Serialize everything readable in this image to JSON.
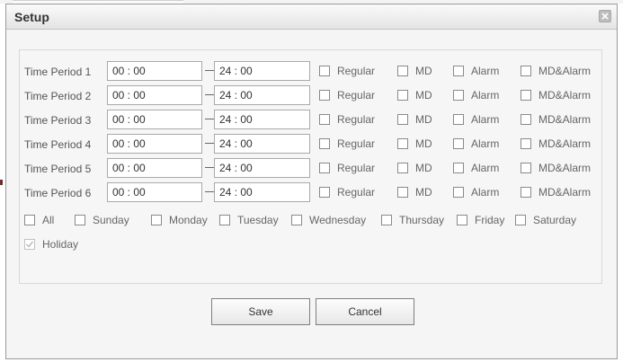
{
  "dialog": {
    "title": "Setup"
  },
  "periods": [
    {
      "label": "Time Period 1",
      "start": "00 : 00",
      "end": "24 : 00"
    },
    {
      "label": "Time Period 2",
      "start": "00 : 00",
      "end": "24 : 00"
    },
    {
      "label": "Time Period 3",
      "start": "00 : 00",
      "end": "24 : 00"
    },
    {
      "label": "Time Period 4",
      "start": "00 : 00",
      "end": "24 : 00"
    },
    {
      "label": "Time Period 5",
      "start": "00 : 00",
      "end": "24 : 00"
    },
    {
      "label": "Time Period 6",
      "start": "00 : 00",
      "end": "24 : 00"
    }
  ],
  "record_types": {
    "regular": "Regular",
    "md": "MD",
    "alarm": "Alarm",
    "md_alarm": "MD&Alarm"
  },
  "days": {
    "all": "All",
    "sunday": "Sunday",
    "monday": "Monday",
    "tuesday": "Tuesday",
    "wednesday": "Wednesday",
    "thursday": "Thursday",
    "friday": "Friday",
    "saturday": "Saturday",
    "holiday": "Holiday"
  },
  "checkbox_state": {
    "holiday_checked": true
  },
  "buttons": {
    "save": "Save",
    "cancel": "Cancel"
  },
  "colors": {
    "dialog_background": "#f5f5f5",
    "border": "#9a9a9a"
  }
}
